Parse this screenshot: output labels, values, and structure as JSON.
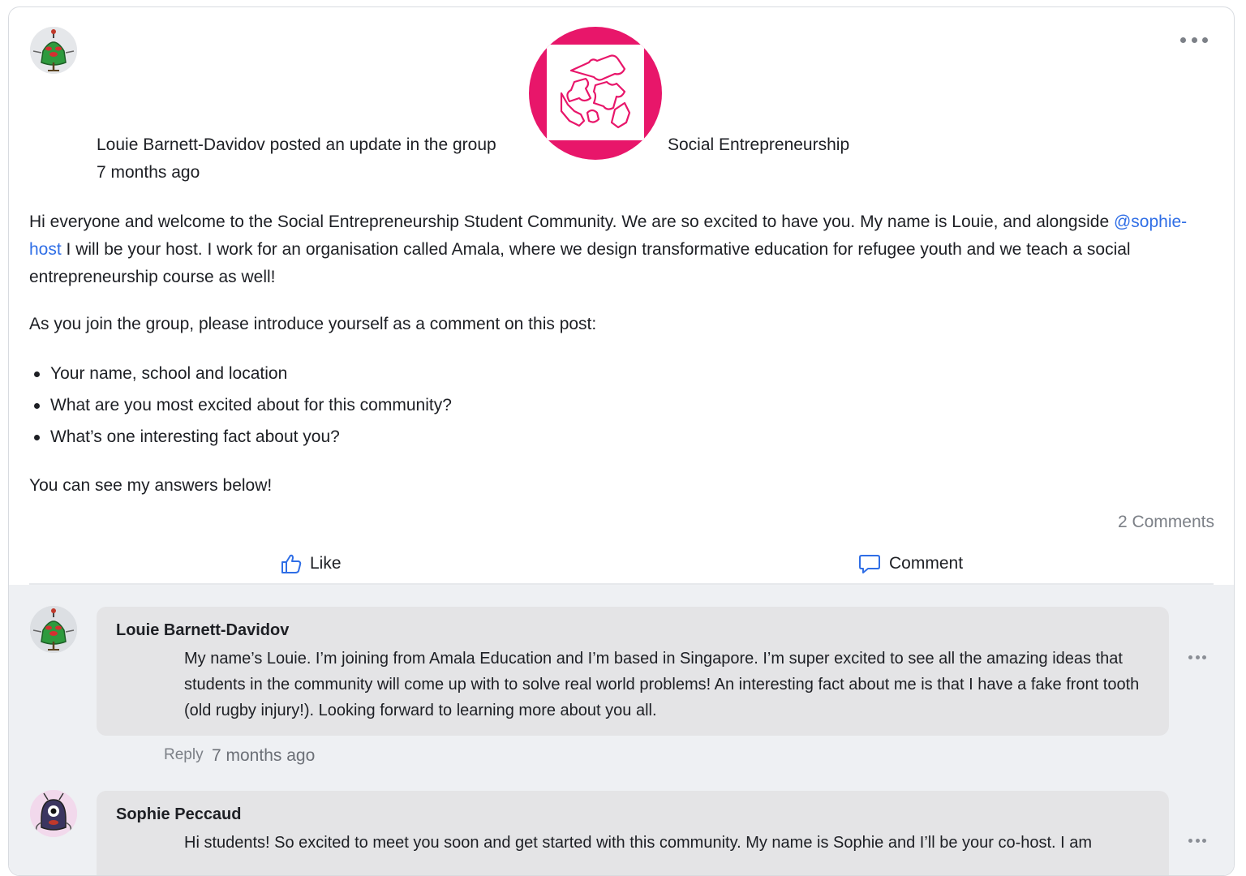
{
  "post": {
    "author": "Louie Barnett-Davidov",
    "action_text": "posted an update in the group",
    "group_name": "Social Entrepreneurship",
    "time_ago": "7 months ago",
    "body": {
      "p1_before_mention": "Hi everyone and welcome to the Social Entrepreneurship Student Community. We are so excited to have you. My name is Louie, and alongside ",
      "mention": "@sophie-host",
      "p1_after_mention": " I will be your host. I work for an organisation called Amala, where we design transformative education for refugee youth and we teach a social entrepreneurship course as well!",
      "p2": "As you join the group, please introduce yourself as a comment on this post:",
      "bullets": [
        "Your name, school and location",
        "What are you most excited about for this community?",
        "What’s one interesting fact about you?"
      ],
      "p3": "You can see my answers below!"
    },
    "comments_count": "2 Comments",
    "like_label": "Like",
    "comment_label": "Comment"
  },
  "comments": [
    {
      "author": "Louie Barnett-Davidov",
      "text": "My name’s Louie. I’m joining from Amala Education and I’m based in Singapore. I’m super excited to see all the amazing ideas that students in the community will come up with to solve real world problems! An interesting fact about me is that I have a fake front tooth (old rugby injury!). Looking forward to learning more about you all.",
      "reply_label": "Reply",
      "time_ago": "7 months ago"
    },
    {
      "author": "Sophie Peccaud",
      "text": "Hi students! So excited to meet you soon and get started with this community. My name is Sophie and I’ll be your co-host. I am"
    }
  ],
  "colors": {
    "accent": "#2f6ee6",
    "group_logo": "#e8166a",
    "comment_bubble": "#e4e4e6",
    "comments_background": "#eef0f3"
  },
  "icons": [
    "author-avatar",
    "group-logo-puzzle",
    "more-options",
    "thumbs-up-icon",
    "comment-bubble-icon"
  ]
}
